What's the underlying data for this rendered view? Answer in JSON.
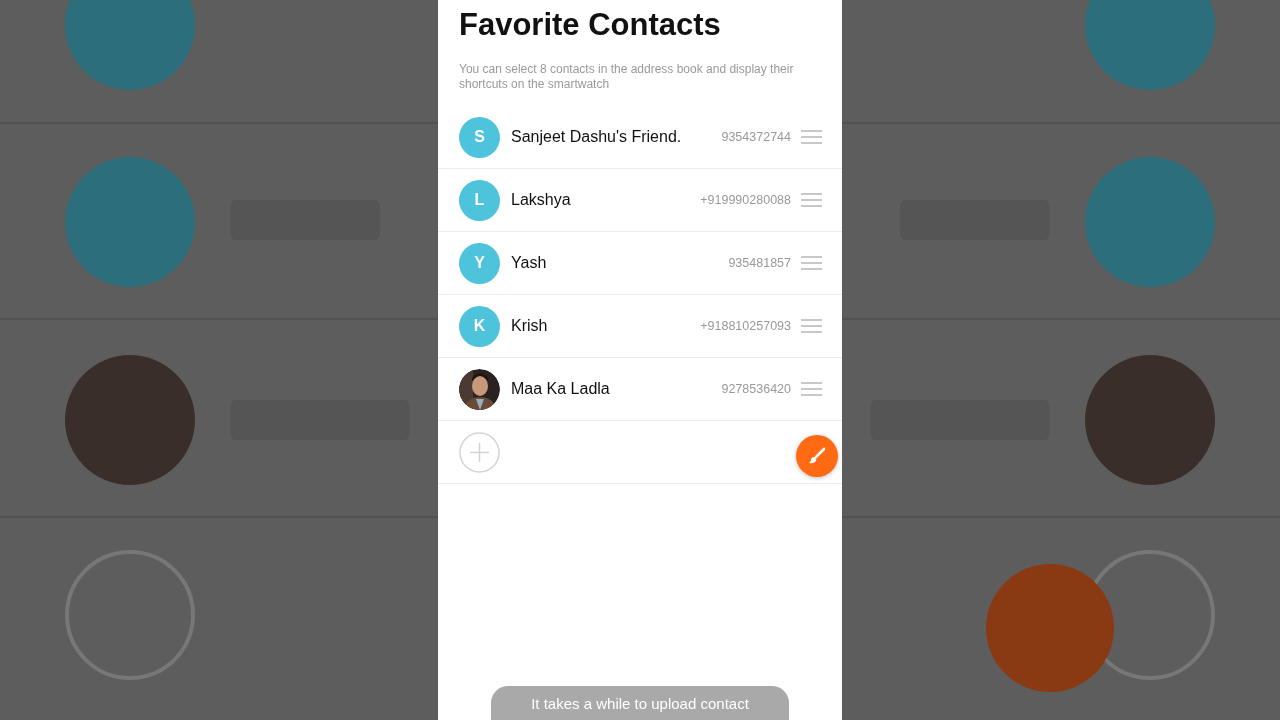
{
  "title": "Favorite Contacts",
  "description": "You can select 8 contacts in the address book and display their shortcuts on the smartwatch",
  "contacts": [
    {
      "name": "Sanjeet Dashu's Friend.",
      "phone": "9354372744",
      "avatar": {
        "kind": "letter",
        "letter": "S"
      }
    },
    {
      "name": "Lakshya",
      "phone": "+919990280088",
      "avatar": {
        "kind": "letter",
        "letter": "L"
      }
    },
    {
      "name": "Yash",
      "phone": "935481857",
      "avatar": {
        "kind": "letter",
        "letter": "Y"
      }
    },
    {
      "name": "Krish",
      "phone": "+918810257093",
      "avatar": {
        "kind": "letter",
        "letter": "K"
      }
    },
    {
      "name": "Maa Ka Ladla",
      "phone": "9278536420"
    }
  ],
  "toast": "It takes a while to upload contact"
}
